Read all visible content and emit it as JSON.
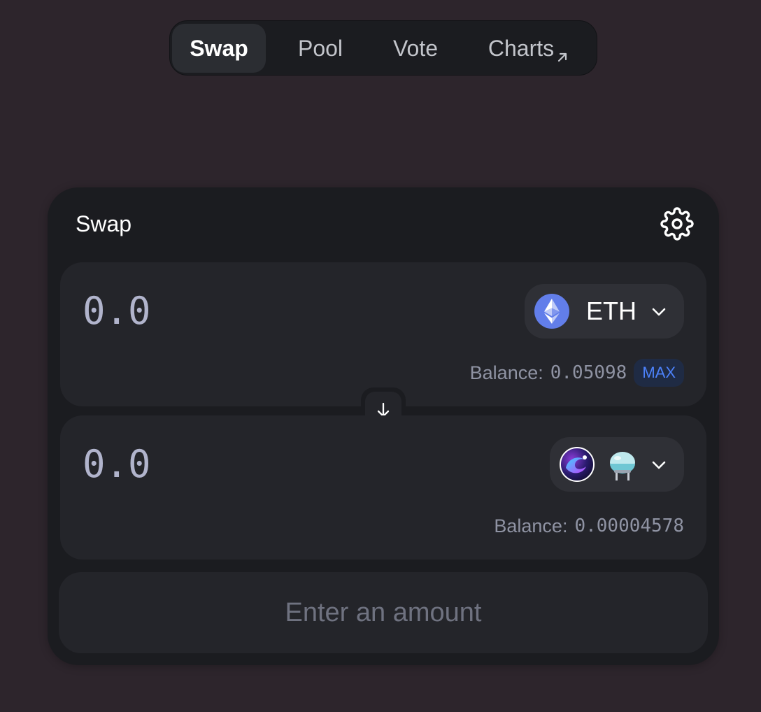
{
  "nav": {
    "items": [
      {
        "label": "Swap",
        "active": true
      },
      {
        "label": "Pool",
        "active": false
      },
      {
        "label": "Vote",
        "active": false
      },
      {
        "label": "Charts",
        "active": false,
        "external_icon": "arrow-up-right-icon"
      }
    ]
  },
  "swap": {
    "title": "Swap",
    "settings_icon": "gear-icon",
    "input": {
      "amount_placeholder": "0.0",
      "token_symbol": "ETH",
      "token_icon": "ethereum-icon",
      "balance_label": "Balance:",
      "balance_value": "0.05098",
      "max_label": "MAX"
    },
    "switch_icon": "arrow-down-icon",
    "output": {
      "amount_placeholder": "0.0",
      "token_icon": "token-logo-icon",
      "token_extra_icon": "flask-icon",
      "balance_label": "Balance:",
      "balance_value": "0.00004578"
    },
    "submit_label": "Enter an amount"
  },
  "colors": {
    "background": "#2d252c",
    "card": "#1b1c20",
    "panel": "#24252a",
    "accent_blue": "#4c82fb",
    "muted_text": "#8f93a3"
  }
}
